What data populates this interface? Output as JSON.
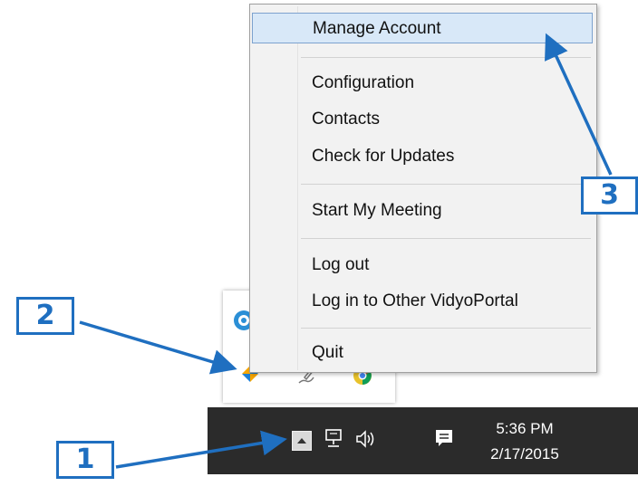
{
  "menu": {
    "items": [
      {
        "label": "Manage Account",
        "selected": true
      },
      {
        "label": "Configuration"
      },
      {
        "label": "Contacts"
      },
      {
        "label": "Check for Updates"
      },
      {
        "label": "Start My Meeting"
      },
      {
        "label": "Log out"
      },
      {
        "label": "Log in to Other VidyoPortal"
      },
      {
        "label": "Quit"
      }
    ]
  },
  "taskbar": {
    "time": "5:36 PM",
    "date": "2/17/2015",
    "icons": [
      "show-hidden-icons",
      "network-icon",
      "volume-icon",
      "action-center-icon"
    ]
  },
  "flyout": {
    "icons": [
      "vidyo-app-icon",
      "shield-app-icon",
      "pen-icon",
      "chrome-icon"
    ]
  },
  "callouts": [
    "1",
    "2",
    "3"
  ],
  "colors": {
    "accent": "#1f6fc0",
    "taskbar": "#2b2b2b",
    "selection": "#d8e8f8"
  }
}
